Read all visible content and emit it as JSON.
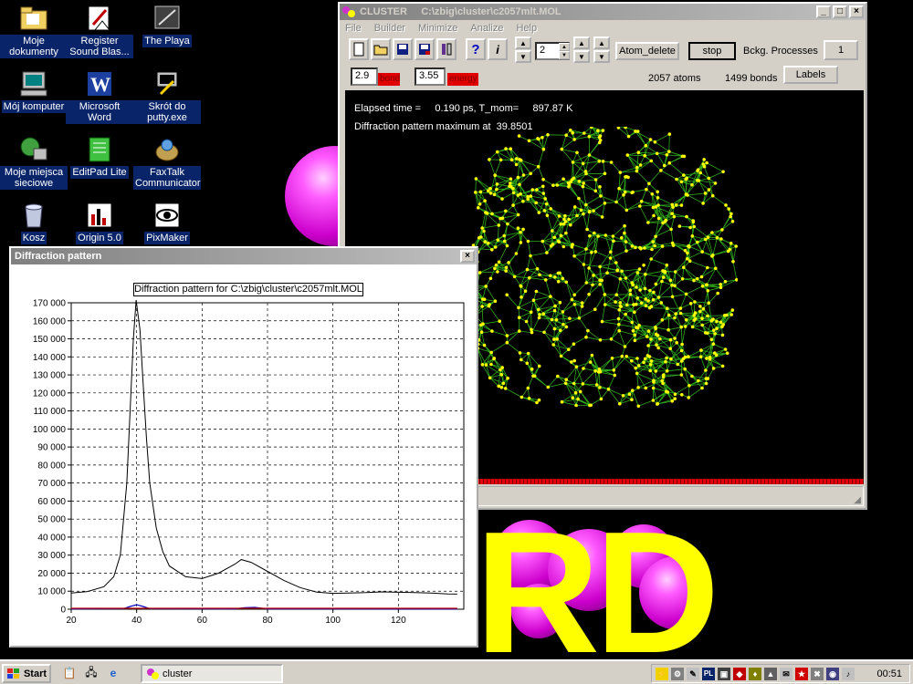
{
  "desktop": {
    "icons": [
      {
        "label": "Moje dokumenty",
        "icon": "folder-icon"
      },
      {
        "label": "Register Sound Blas...",
        "icon": "register-icon"
      },
      {
        "label": "The Playa",
        "icon": "shortcut-icon"
      },
      {
        "label": "Mój komputer",
        "icon": "computer-icon"
      },
      {
        "label": "Microsoft Word",
        "icon": "word-icon"
      },
      {
        "label": "Skrót do putty.exe",
        "icon": "putty-icon"
      },
      {
        "label": "Moje miejsca sieciowe",
        "icon": "network-icon"
      },
      {
        "label": "EditPad Lite",
        "icon": "editpad-icon"
      },
      {
        "label": "FaxTalk Communicator",
        "icon": "fax-icon"
      },
      {
        "label": "Kosz",
        "icon": "recycle-bin-icon"
      },
      {
        "label": "Origin 5.0",
        "icon": "origin-icon"
      },
      {
        "label": "PixMaker",
        "icon": "pixmaker-icon"
      }
    ],
    "wallpaper_text": "RD"
  },
  "cluster_window": {
    "title": "CLUSTER     C:\\zbig\\cluster\\c2057mlt.MOL",
    "menu": [
      "File",
      "Builder",
      "Minimize",
      "Analize",
      "Help"
    ],
    "spinner_value": "2",
    "atom_delete_label": "Atom_delete",
    "stop_label": "stop",
    "bckg_processes_label": "Bckg. Processes",
    "bckg_processes_value": "1",
    "bond_value": "2.9",
    "bond_label": "bond",
    "energy_value": "3.55",
    "energy_label": "energy",
    "atoms_text": "2057 atoms",
    "bonds_text": "1499 bonds",
    "labels_button": "Labels",
    "elapsed_text": "Elapsed time =     0.190 ps, T_mom=     897.87 K",
    "diffraction_max_text": "Diffraction pattern maximum at  39.8501"
  },
  "diffraction_window": {
    "title": "Diffraction pattern",
    "close_label": "×"
  },
  "chart_data": {
    "type": "line",
    "title": "Diffraction pattern for C:\\zbig\\cluster\\c2057mlt.MOL",
    "xlabel": "",
    "ylabel": "",
    "xlim": [
      20,
      140
    ],
    "ylim": [
      0,
      170000
    ],
    "x_ticks": [
      "20",
      "40",
      "60",
      "80",
      "100",
      "120"
    ],
    "y_ticks": [
      "0",
      "10 000",
      "20 000",
      "30 000",
      "40 000",
      "50 000",
      "60 000",
      "70 000",
      "80 000",
      "90 000",
      "100 000",
      "110 000",
      "120 000",
      "130 000",
      "140 000",
      "150 000",
      "160 000",
      "170 000"
    ],
    "grid": true,
    "series": [
      {
        "color": "#000000",
        "x": [
          20,
          25,
          30,
          33,
          35,
          37,
          38,
          39,
          39.85,
          41,
          42,
          43,
          44,
          46,
          48,
          50,
          55,
          60,
          65,
          70,
          72,
          75,
          80,
          85,
          90,
          95,
          100,
          105,
          110,
          115,
          120,
          125,
          130,
          135,
          138
        ],
        "y": [
          9000,
          9800,
          12500,
          18000,
          30000,
          70000,
          110000,
          150000,
          171500,
          155000,
          125000,
          95000,
          70000,
          45000,
          32000,
          24000,
          18000,
          17000,
          20000,
          25000,
          27500,
          26000,
          21000,
          16000,
          12000,
          9500,
          8800,
          9000,
          9200,
          9600,
          9400,
          9200,
          9000,
          8500,
          8400
        ]
      },
      {
        "color": "#0000c0",
        "x": [
          20,
          36,
          38,
          40,
          42,
          44,
          70,
          73,
          76,
          80,
          138
        ],
        "y": [
          200,
          300,
          1500,
          2500,
          1500,
          300,
          200,
          800,
          1000,
          200,
          100
        ]
      },
      {
        "color": "#c00000",
        "x": [
          20,
          138
        ],
        "y": [
          500,
          500
        ]
      }
    ]
  },
  "taskbar": {
    "start_label": "Start",
    "task_label": "cluster",
    "clock": "00:51",
    "tray_lang": "PL"
  },
  "colors": {
    "title_active": "#0a246a",
    "plot_line": "#000000",
    "atom_color": "#ffff00",
    "bond_color": "#2fa81a"
  }
}
